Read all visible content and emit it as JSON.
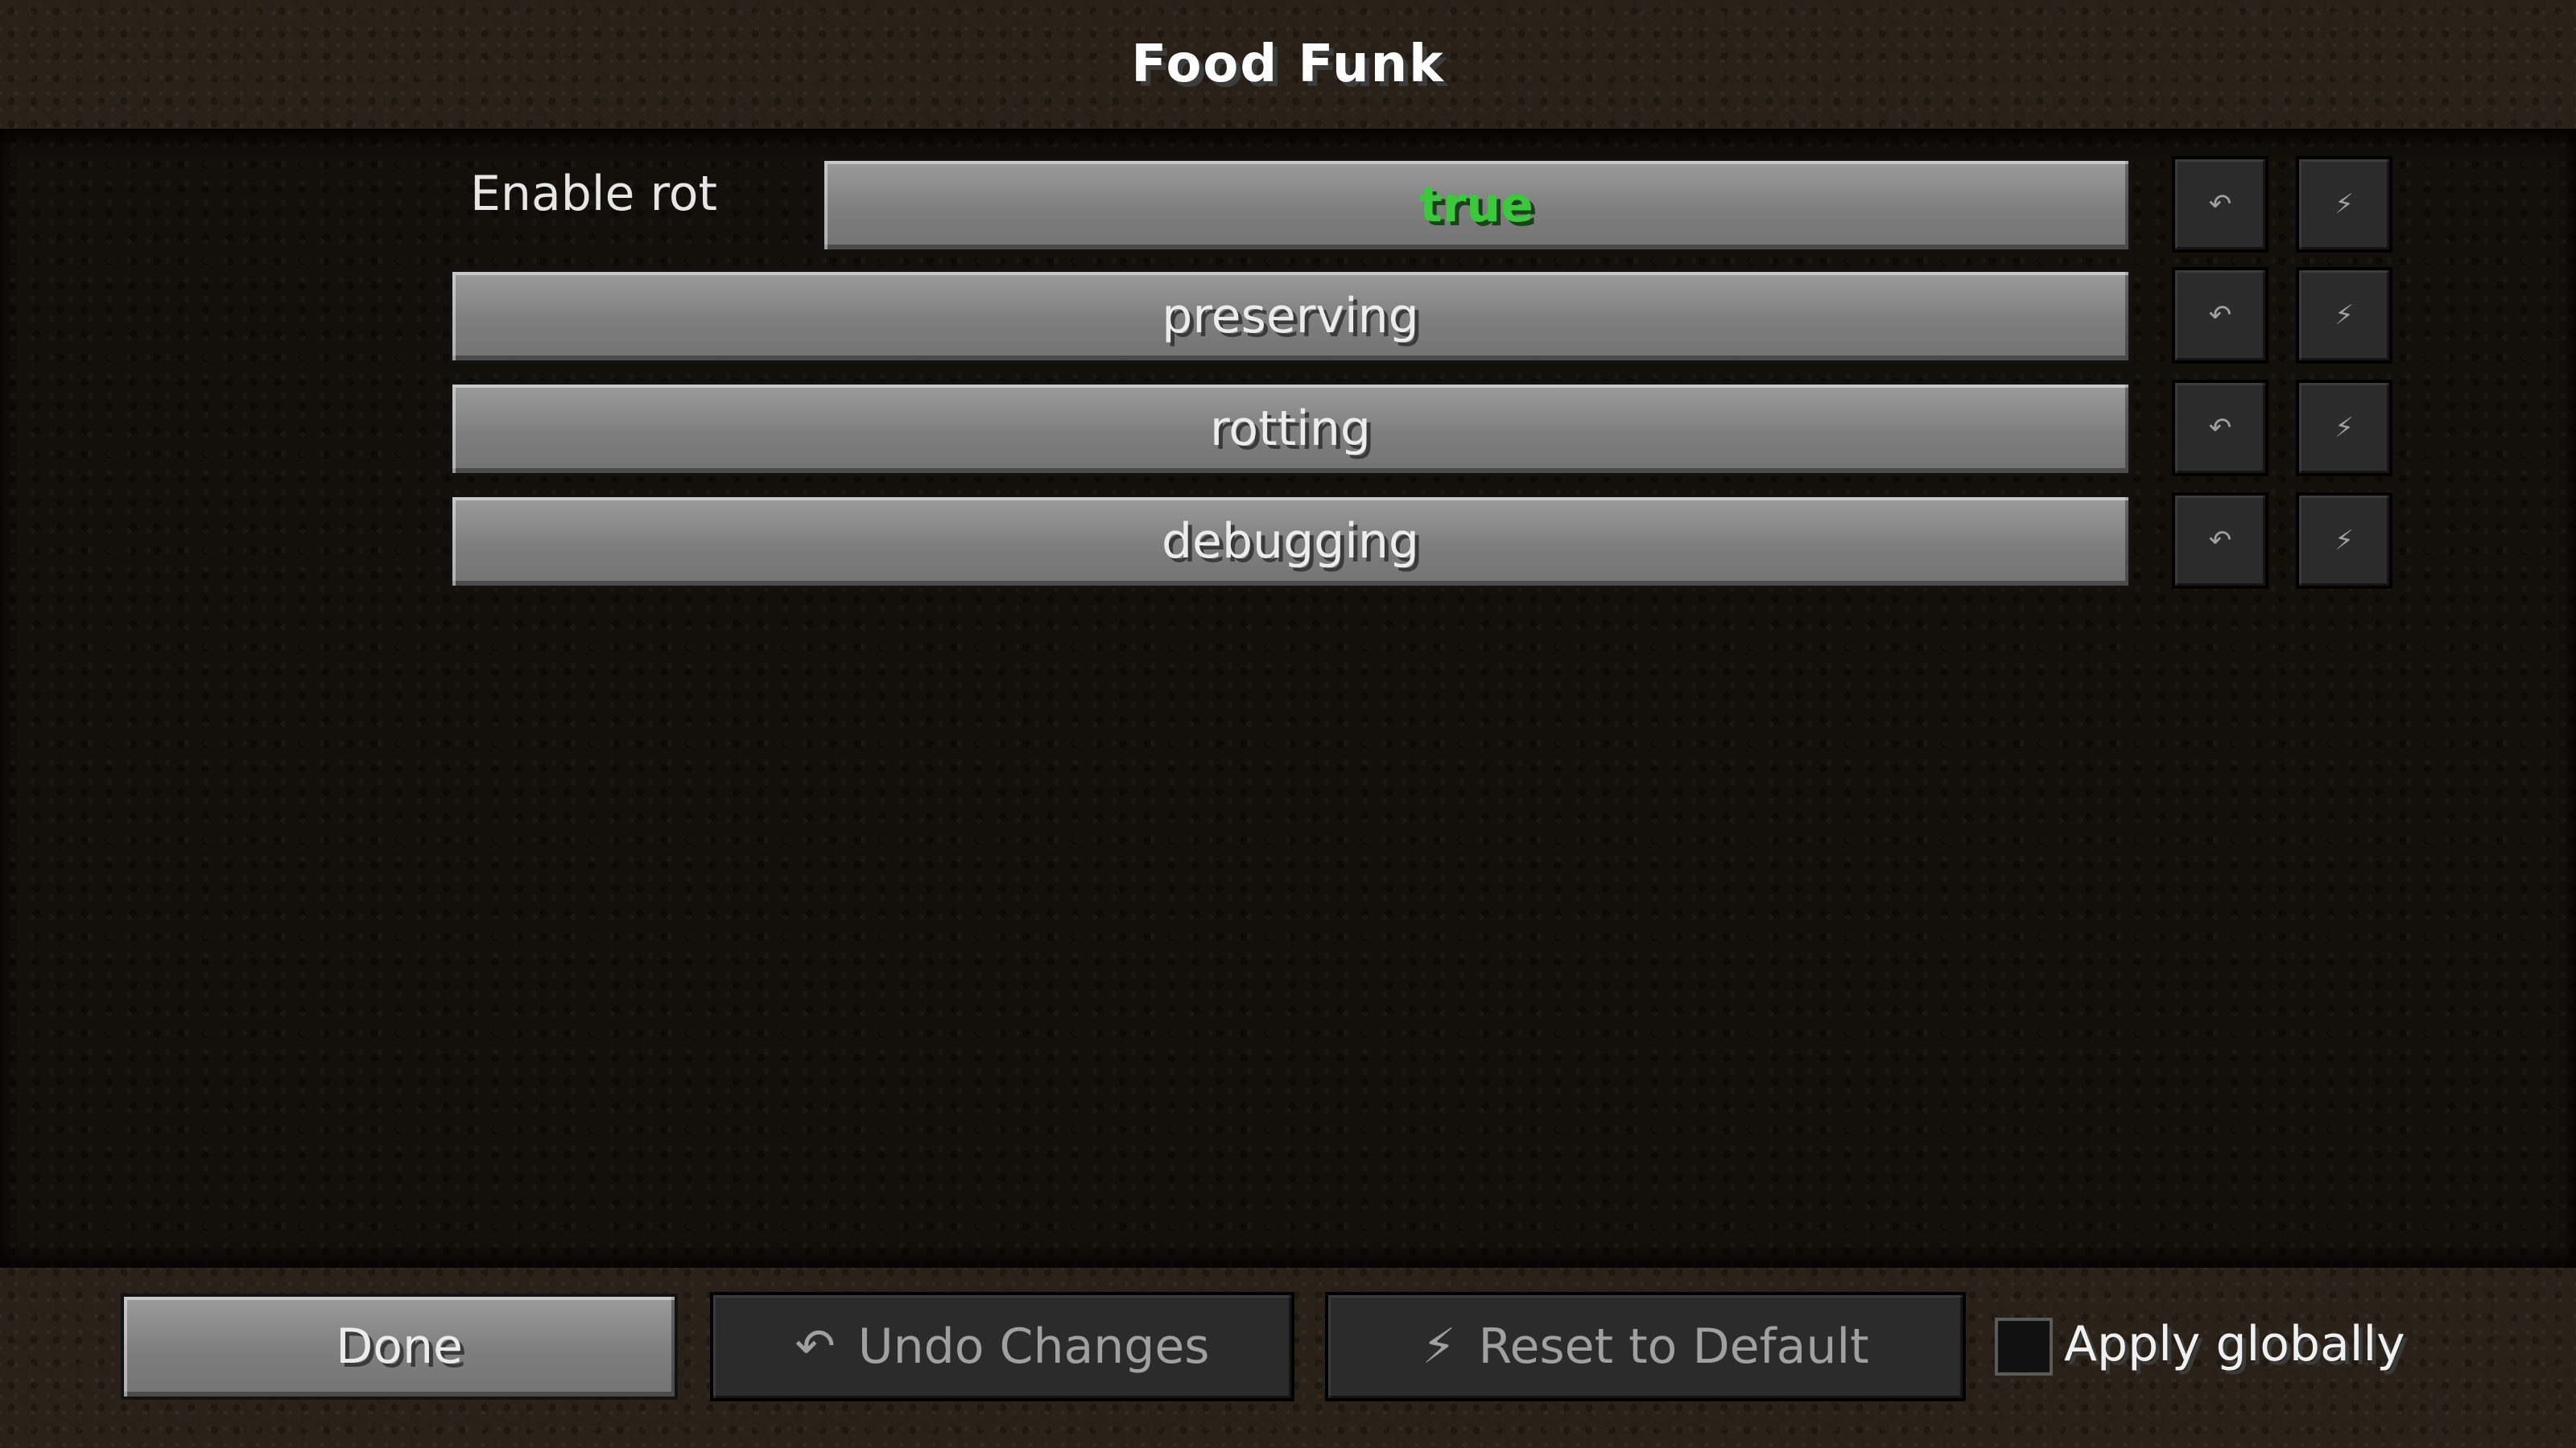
{
  "screen": {
    "title": "Food Funk"
  },
  "options": [
    {
      "label": "Enable rot",
      "value": "true",
      "value_color": "#3cc83c",
      "undo_icon": "↶",
      "reset_icon": "⚡"
    },
    {
      "label": "preserving",
      "undo_icon": "↶",
      "reset_icon": "⚡"
    },
    {
      "label": "rotting",
      "undo_icon": "↶",
      "reset_icon": "⚡"
    },
    {
      "label": "debugging",
      "undo_icon": "↶",
      "reset_icon": "⚡"
    }
  ],
  "footer": {
    "done_label": "Done",
    "undo_icon": "↶",
    "undo_label": "Undo Changes",
    "reset_icon": "⚡",
    "reset_label": "Reset to Default",
    "apply_globally_label": "Apply globally",
    "apply_globally_checked": false
  },
  "icons": {
    "undo": "undo-arrow-icon",
    "reset": "reset-lightning-icon"
  },
  "colors": {
    "true_value": "#3cc83c",
    "button_face": "#8a8a8a",
    "disabled_button": "#2b2b2b"
  }
}
